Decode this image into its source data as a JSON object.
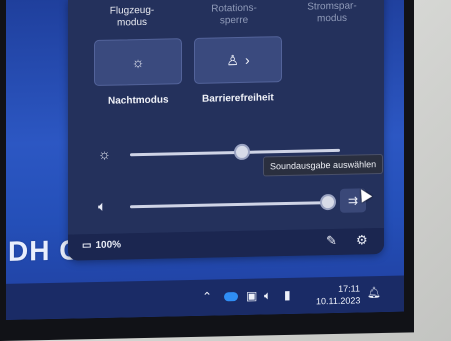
{
  "quick_settings": {
    "row1": {
      "flight_mode_label": "Flugzeug-\nmodus",
      "rotation_lock_label": "Rotations-\nsperre",
      "battery_saver_label": "Stromspar-\nmodus"
    },
    "tiles": [
      {
        "label": "Nachtmodus",
        "icon": "sun-icon"
      },
      {
        "label": "Barrierefreiheit",
        "icon": "accessibility-icon",
        "has_chevron": true
      }
    ],
    "brightness": {
      "icon": "brightness-icon",
      "level_percent": 50
    },
    "volume": {
      "icon": "speaker-icon",
      "level_percent": 100
    },
    "sound_output_tooltip": "Soundausgabe auswählen",
    "footer": {
      "battery_text": "100%",
      "edit_icon": "pencil-icon",
      "settings_icon": "gear-icon"
    }
  },
  "wallpaper_text": "DH C",
  "taskbar": {
    "chevron_icon": "chevron-up-icon",
    "onedrive_icon": "cloud-icon",
    "network_icon": "network-icon",
    "volume_icon": "speaker-icon",
    "battery_icon": "battery-icon",
    "time": "17:11",
    "date": "10.11.2023",
    "notification_icon": "bell-icon"
  },
  "colors": {
    "panel_bg": "#24315c",
    "wallpaper_blue": "#2c57c3",
    "accent_blue": "#2f8ef5"
  }
}
